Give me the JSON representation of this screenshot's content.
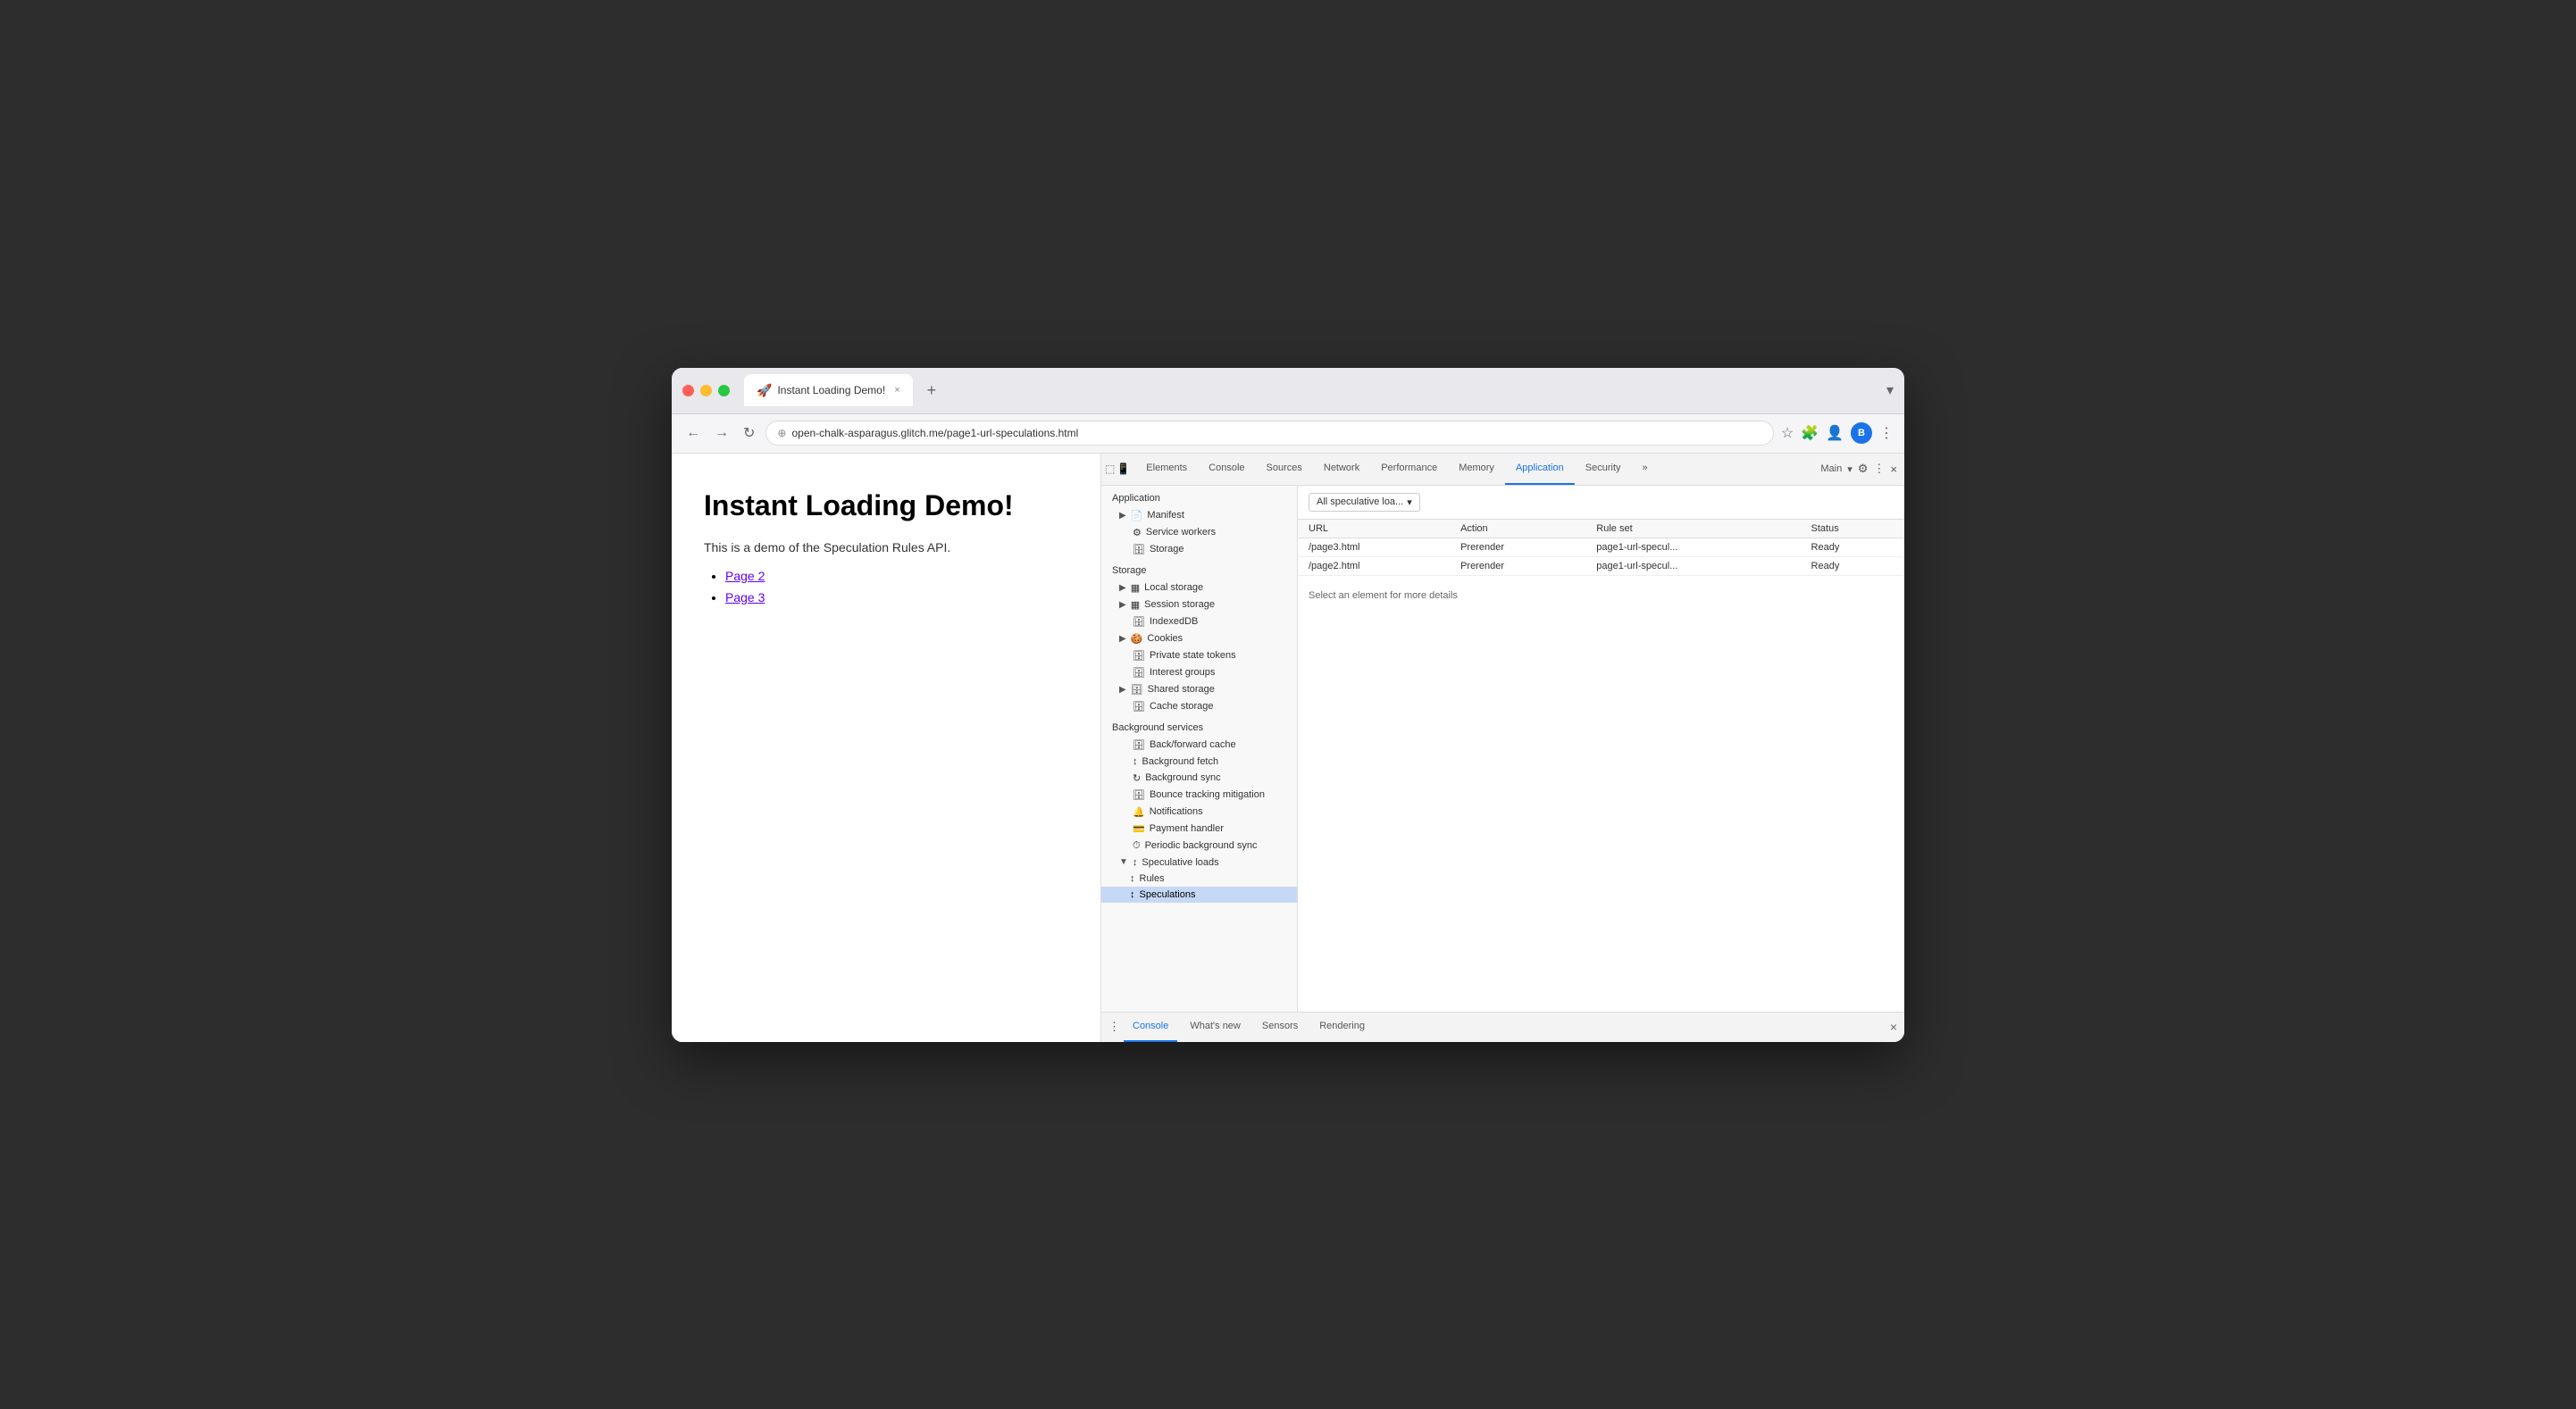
{
  "browser": {
    "tab_title": "Instant Loading Demo!",
    "tab_favicon": "🚀",
    "tab_close": "×",
    "tab_add": "+",
    "url": "open-chalk-asparagus.glitch.me/page1-url-speculations.html",
    "nav_back": "←",
    "nav_forward": "→",
    "nav_reload": "↻",
    "nav_security": "⊕",
    "nav_star": "☆",
    "nav_extensions": "🧩",
    "nav_account": "⊕",
    "nav_avatar": "B",
    "nav_menu": "⋮",
    "dropdown_arrow": "▾"
  },
  "page": {
    "title": "Instant Loading Demo!",
    "subtitle": "This is a demo of the Speculation Rules API.",
    "links": [
      {
        "text": "Page 2",
        "href": "#"
      },
      {
        "text": "Page 3",
        "href": "#"
      }
    ]
  },
  "devtools": {
    "tabs": [
      {
        "label": "Elements",
        "active": false
      },
      {
        "label": "Console",
        "active": false
      },
      {
        "label": "Sources",
        "active": false
      },
      {
        "label": "Network",
        "active": false
      },
      {
        "label": "Performance",
        "active": false
      },
      {
        "label": "Memory",
        "active": false
      },
      {
        "label": "Application",
        "active": true
      },
      {
        "label": "Security",
        "active": false
      }
    ],
    "more_tabs": "»",
    "context": "Main",
    "gear_icon": "⚙",
    "more_icon": "⋮",
    "close_icon": "×",
    "inspect_icon": "⬚",
    "device_icon": "📱",
    "sidebar": {
      "sections": [
        {
          "label": "Application",
          "items": [
            {
              "icon": "▶",
              "text": "Manifest",
              "indent": 0,
              "expandable": true
            },
            {
              "icon": "⚙",
              "text": "Service workers",
              "indent": 0
            },
            {
              "icon": "🗄",
              "text": "Storage",
              "indent": 0
            }
          ]
        },
        {
          "label": "Storage",
          "items": [
            {
              "icon": "▶",
              "text": "Local storage",
              "indent": 0,
              "expandable": true,
              "table_icon": true
            },
            {
              "icon": "▶",
              "text": "Session storage",
              "indent": 0,
              "expandable": true,
              "table_icon": true
            },
            {
              "icon": "",
              "text": "IndexedDB",
              "indent": 0
            },
            {
              "icon": "▶",
              "text": "Cookies",
              "indent": 0,
              "expandable": true
            },
            {
              "icon": "",
              "text": "Private state tokens",
              "indent": 0
            },
            {
              "icon": "",
              "text": "Interest groups",
              "indent": 0
            },
            {
              "icon": "▶",
              "text": "Shared storage",
              "indent": 0,
              "expandable": true
            },
            {
              "icon": "",
              "text": "Cache storage",
              "indent": 0
            }
          ]
        },
        {
          "label": "Background services",
          "items": [
            {
              "icon": "",
              "text": "Back/forward cache",
              "indent": 0
            },
            {
              "icon": "↕",
              "text": "Background fetch",
              "indent": 0
            },
            {
              "icon": "↻",
              "text": "Background sync",
              "indent": 0
            },
            {
              "icon": "",
              "text": "Bounce tracking mitigation",
              "indent": 0
            },
            {
              "icon": "🔔",
              "text": "Notifications",
              "indent": 0
            },
            {
              "icon": "",
              "text": "Payment handler",
              "indent": 0
            },
            {
              "icon": "⏱",
              "text": "Periodic background sync",
              "indent": 0
            },
            {
              "icon": "▼",
              "text": "Speculative loads",
              "indent": 0,
              "expanded": true
            },
            {
              "icon": "↕",
              "text": "Rules",
              "indent": 1
            },
            {
              "icon": "↕",
              "text": "Speculations",
              "indent": 1,
              "active": true
            }
          ]
        }
      ]
    },
    "main": {
      "dropdown_label": "All speculative loa...",
      "table": {
        "columns": [
          "URL",
          "Action",
          "Rule set",
          "Status"
        ],
        "rows": [
          {
            "url": "/page3.html",
            "action": "Prerender",
            "rule_set": "page1-url-specul...",
            "status": "Ready"
          },
          {
            "url": "/page2.html",
            "action": "Prerender",
            "rule_set": "page1-url-specul...",
            "status": "Ready"
          }
        ]
      },
      "select_message": "Select an element for more details"
    },
    "bottom_tabs": [
      {
        "label": "Console",
        "active": true
      },
      {
        "label": "What's new",
        "active": false
      },
      {
        "label": "Sensors",
        "active": false
      },
      {
        "label": "Rendering",
        "active": false
      }
    ],
    "bottom_menu": "⋮",
    "bottom_close": "×"
  }
}
